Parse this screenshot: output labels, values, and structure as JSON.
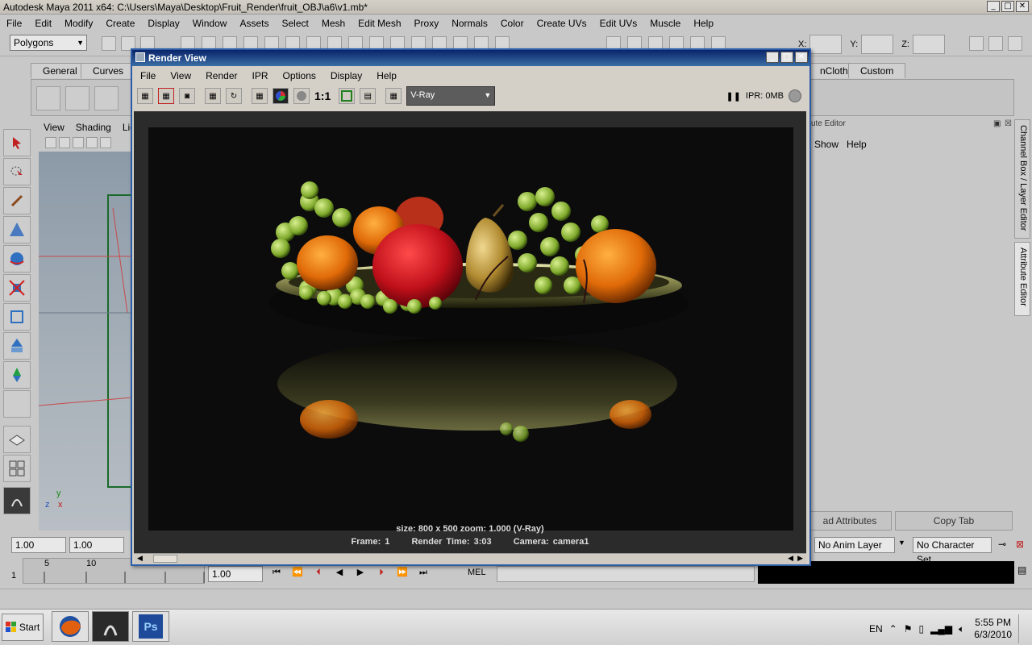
{
  "app": {
    "title": "Autodesk Maya 2011 x64: C:\\Users\\Maya\\Desktop\\Fruit_Render\\fruit_OBJ\\a6\\v1.mb*",
    "menus": [
      "File",
      "Edit",
      "Modify",
      "Create",
      "Display",
      "Window",
      "Assets",
      "Select",
      "Mesh",
      "Edit Mesh",
      "Proxy",
      "Normals",
      "Color",
      "Create UVs",
      "Edit UVs",
      "Muscle",
      "Help"
    ],
    "window_buttons": {
      "min": "_",
      "max": "□",
      "close": "✕"
    }
  },
  "status_line": {
    "menu_set": "Polygons",
    "x_label": "X:",
    "y_label": "Y:",
    "z_label": "Z:"
  },
  "shelf": {
    "tabs": [
      "General",
      "Curves"
    ],
    "right_tabs": [
      "nCloth",
      "Custom"
    ]
  },
  "viewport": {
    "menus": [
      "View",
      "Shading",
      "Ligh"
    ],
    "axis": {
      "y": "y",
      "z": "z",
      "x": "x"
    }
  },
  "attribute_editor": {
    "header": "ute Editor",
    "menus": [
      "Show",
      "Help"
    ],
    "side_tabs": [
      "Channel Box / Layer Editor",
      "Attribute Editor"
    ],
    "load_button": "ad Attributes",
    "copy_button": "Copy Tab"
  },
  "range": {
    "start": "1.00",
    "start2": "1.00",
    "current": "1.00",
    "anim_layer": "No Anim Layer",
    "char_set": "No Character Set"
  },
  "timeline": {
    "frame": "1",
    "ticks": [
      "5",
      "10"
    ],
    "mel_label": "MEL"
  },
  "render_view": {
    "title": "Render View",
    "menus": [
      "File",
      "View",
      "Render",
      "IPR",
      "Options",
      "Display",
      "Help"
    ],
    "ratio_label": "1:1",
    "renderer": "V-Ray",
    "ipr_label": "IPR: 0MB",
    "info_line1": "size: 800 x 500 zoom: 1.000      (V-Ray)",
    "frame_text": "Frame: 1",
    "render_time": "Render Time:  3:03",
    "camera": "Camera: camera1"
  },
  "taskbar": {
    "start": "Start",
    "language": "EN",
    "time": "5:55 PM",
    "date": "6/3/2010",
    "ps_label": "Ps"
  }
}
